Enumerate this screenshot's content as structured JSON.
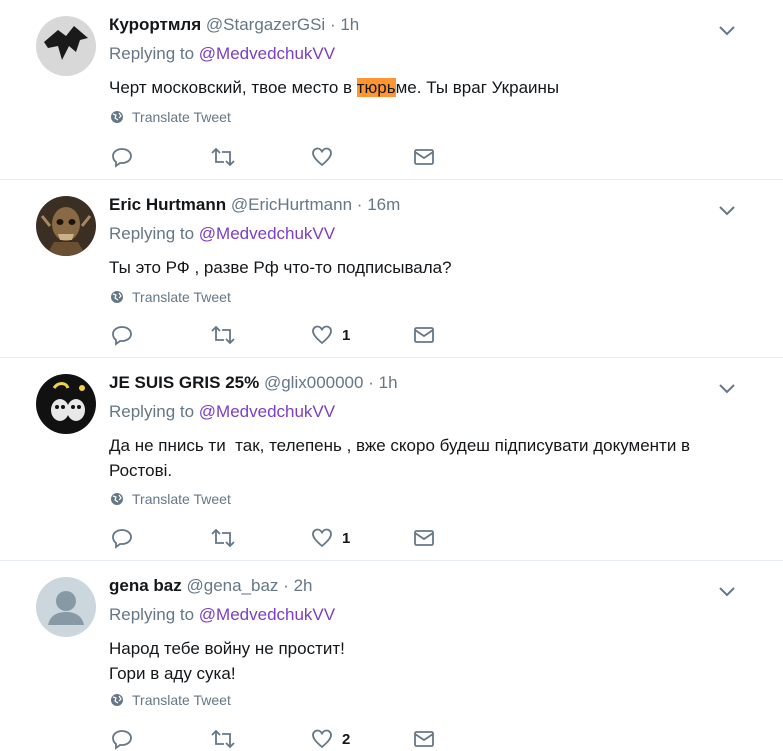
{
  "replying_prefix": "Replying to ",
  "translate_label": "Translate Tweet",
  "tweets": [
    {
      "name": "Курортмля",
      "handle": "@StargazerGSi",
      "time": "1h",
      "reply_to": "@MedvedchukVV",
      "text_before": "Черт московский, твое место в ",
      "text_highlight": "тюрь",
      "text_after": "ме. Ты враг Украины",
      "likes": ""
    },
    {
      "name": "Eric Hurtmann",
      "handle": "@EricHurtmann",
      "time": "16m",
      "reply_to": "@MedvedchukVV",
      "text": "Ты это РФ , разве Рф что-то подписывала?",
      "likes": "1"
    },
    {
      "name": "JE SUIS GRIS 25%",
      "handle": "@glix000000",
      "time": "1h",
      "reply_to": "@MedvedchukVV",
      "text_line1": "Да не пнись ти  так, телепень , вже скоро будеш підписувати документи в",
      "text_line2": "Ростові.",
      "likes": "1"
    },
    {
      "name": "gena baz",
      "handle": "@gena_baz",
      "time": "2h",
      "reply_to": "@MedvedchukVV",
      "text_line1": "Народ тебе войну не простит!",
      "text_line2": "Гори в аду сука!",
      "likes": "2"
    }
  ],
  "icons": {
    "reply": "reply-icon",
    "retweet": "retweet-icon",
    "like": "heart-icon",
    "dm": "envelope-icon",
    "caret": "chevron-down-icon",
    "globe": "globe-icon"
  },
  "colors": {
    "text": "#14171a",
    "secondary": "#657786",
    "mention": "#7b3fc4",
    "highlight": "#ff9632",
    "divider": "#e6ecf0"
  }
}
